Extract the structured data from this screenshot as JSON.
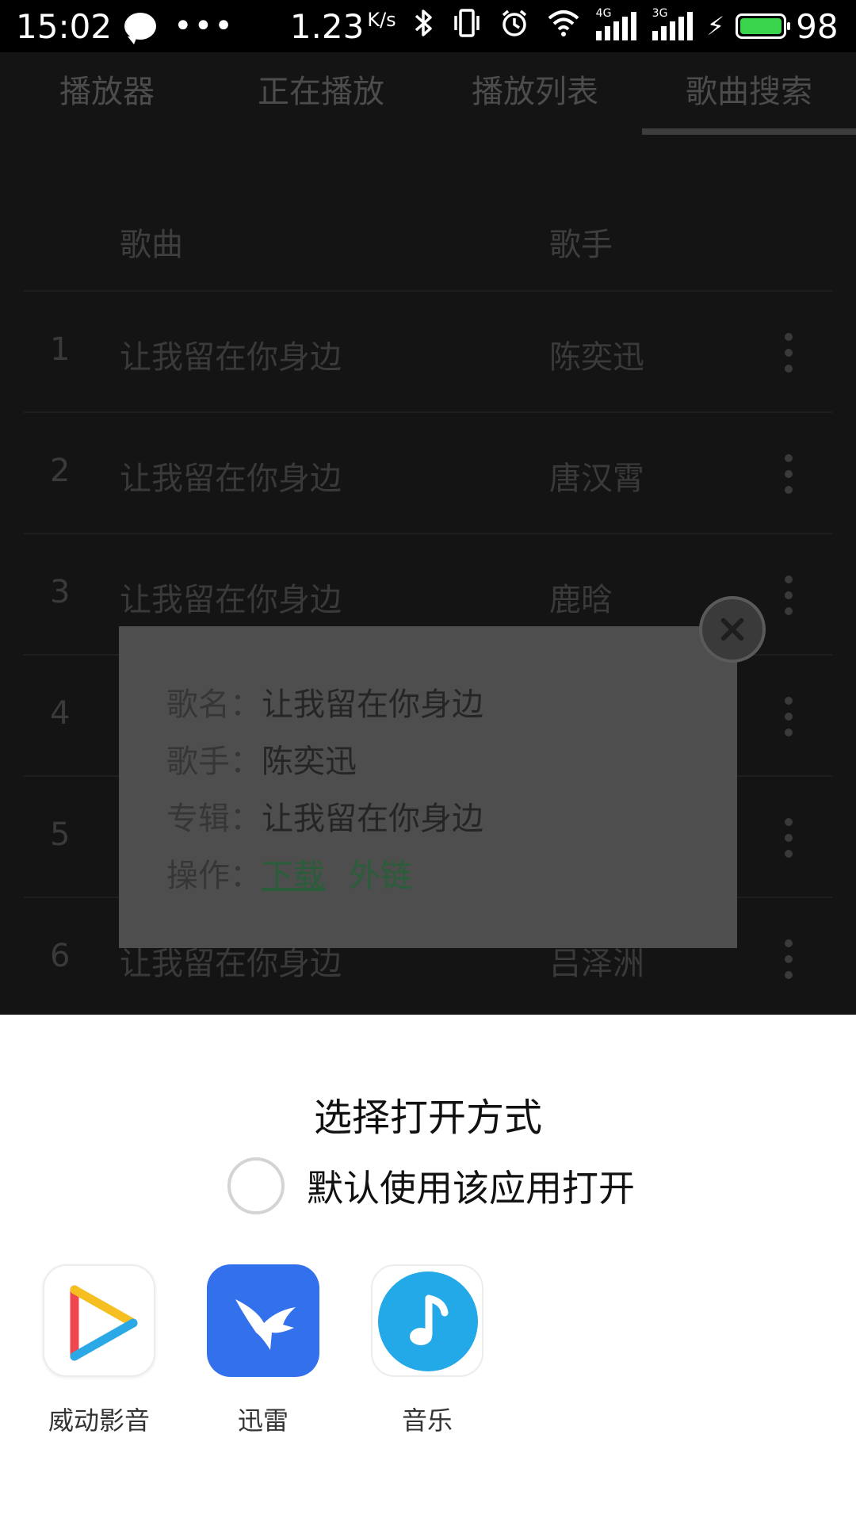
{
  "status_bar": {
    "time": "15:02",
    "dots": "•••",
    "net_speed": "1.23",
    "net_unit": "K/s",
    "battery_level": "98",
    "signal_1_tag": "4G",
    "signal_2_tag": "3G"
  },
  "tabs": [
    {
      "label": "播放器"
    },
    {
      "label": "正在播放"
    },
    {
      "label": "播放列表"
    },
    {
      "label": "歌曲搜索",
      "active": true
    }
  ],
  "list": {
    "header": {
      "song": "歌曲",
      "singer": "歌手"
    },
    "rows": [
      {
        "index": "1",
        "song": "让我留在你身边",
        "singer": "陈奕迅"
      },
      {
        "index": "2",
        "song": "让我留在你身边",
        "singer": "唐汉霄"
      },
      {
        "index": "3",
        "song": "让我留在你身边",
        "singer": "鹿晗"
      },
      {
        "index": "4",
        "song": "",
        "singer": ""
      },
      {
        "index": "5",
        "song": "",
        "singer": ""
      },
      {
        "index": "6",
        "song": "让我留在你身边",
        "singer": "吕泽洲"
      }
    ]
  },
  "popup": {
    "song_key": "歌名：",
    "song_val": "让我留在你身边",
    "singer_key": "歌手：",
    "singer_val": "陈奕迅",
    "album_key": "专辑：",
    "album_val": "让我留在你身边",
    "action_key": "操作：",
    "download": "下载",
    "external_link": "外链"
  },
  "sheet": {
    "title": "选择打开方式",
    "default_label": "默认使用该应用打开",
    "apps": [
      {
        "name": "威动影音",
        "icon": "play-triangle-icon"
      },
      {
        "name": "迅雷",
        "icon": "hummingbird-icon"
      },
      {
        "name": "音乐",
        "icon": "music-note-icon"
      }
    ]
  },
  "colors": {
    "accent_link": "#2a5d39",
    "xunlei_blue": "#3370ec",
    "music_blue": "#23a9e8",
    "battery_green": "#39d34c"
  }
}
